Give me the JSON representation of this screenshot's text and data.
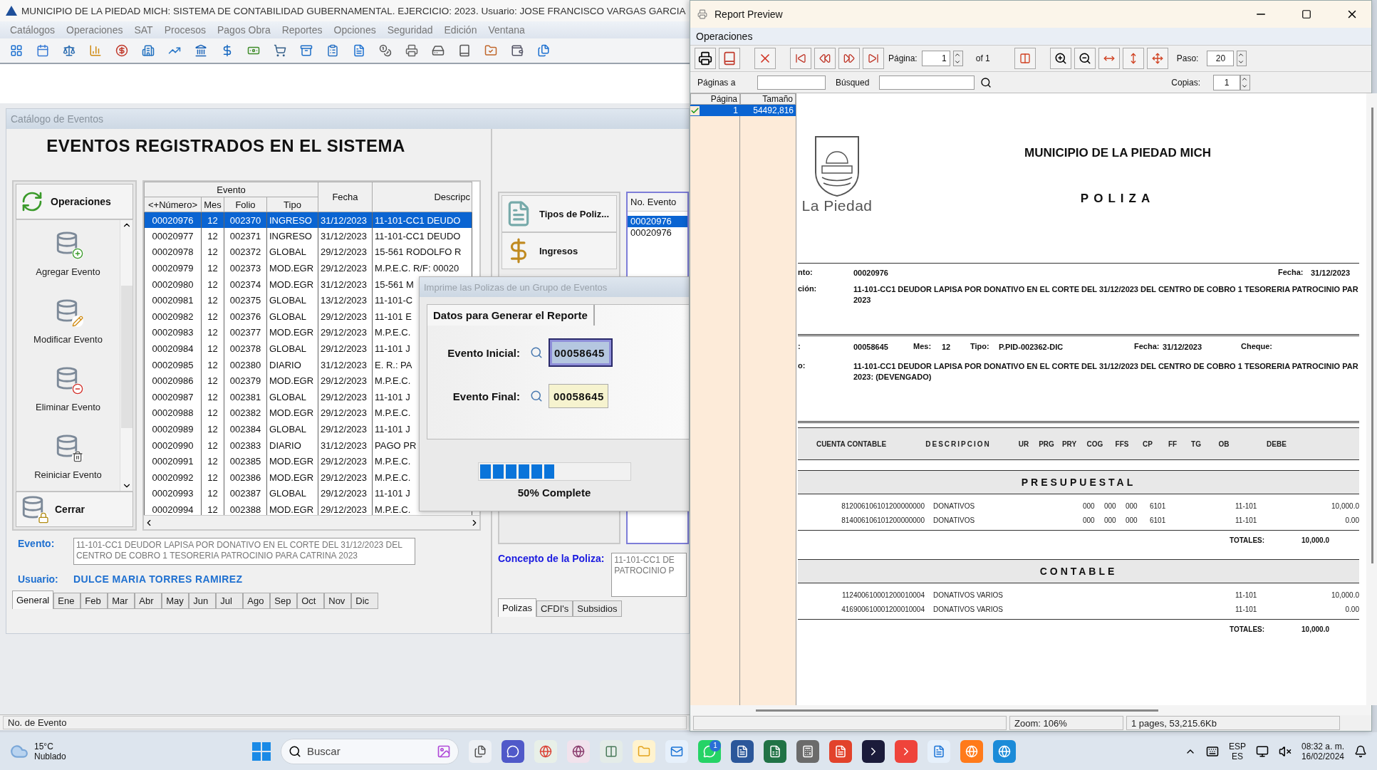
{
  "main_window": {
    "title": "MUNICIPIO DE LA PIEDAD MICH: SISTEMA DE CONTABILIDAD GUBERNAMENTAL. EJERCICIO: 2023. Usuario: JOSE FRANCISCO VARGAS GARCIA",
    "menu": [
      "Catálogos",
      "Operaciones",
      "SAT",
      "Procesos",
      "Pagos Obra",
      "Reportes",
      "Opciones",
      "Seguridad",
      "Edición",
      "Ventana"
    ],
    "status_bar": "No. de Evento"
  },
  "catalog": {
    "title": "Catálogo de Eventos",
    "heading": "EVENTOS REGISTRADOS EN EL SISTEMA",
    "operations": {
      "header": "Operaciones",
      "items": [
        {
          "label": "Agregar Evento",
          "kind": "add"
        },
        {
          "label": "Modificar Evento",
          "kind": "edit"
        },
        {
          "label": "Eliminar Evento",
          "kind": "delete"
        },
        {
          "label": "Reiniciar Evento",
          "kind": "reset"
        }
      ],
      "close": "Cerrar"
    },
    "table": {
      "group": "Evento",
      "columns": [
        "<+Número>",
        "Mes",
        "Folio",
        "Tipo",
        "Fecha",
        "Descripc"
      ],
      "rows": [
        {
          "cells": [
            "00020976",
            "12",
            "002370",
            "INGRESO",
            "31/12/2023",
            "11-101-CC1 DEUDO"
          ],
          "selected": true
        },
        {
          "cells": [
            "00020977",
            "12",
            "002371",
            "INGRESO",
            "31/12/2023",
            "11-101-CC1 DEUDO"
          ],
          "selected": false
        },
        {
          "cells": [
            "00020978",
            "12",
            "002372",
            "GLOBAL",
            "29/12/2023",
            "15-561 RODOLFO R"
          ],
          "selected": false
        },
        {
          "cells": [
            "00020979",
            "12",
            "002373",
            "MOD.EGR",
            "29/12/2023",
            "M.P.E.C. R/F: 00020"
          ],
          "selected": false
        },
        {
          "cells": [
            "00020980",
            "12",
            "002374",
            "MOD.EGR",
            "31/12/2023",
            "15-561 M"
          ],
          "selected": false
        },
        {
          "cells": [
            "00020981",
            "12",
            "002375",
            "GLOBAL",
            "13/12/2023",
            "11-101-C"
          ],
          "selected": false
        },
        {
          "cells": [
            "00020982",
            "12",
            "002376",
            "GLOBAL",
            "29/12/2023",
            "11-101 E"
          ],
          "selected": false
        },
        {
          "cells": [
            "00020983",
            "12",
            "002377",
            "MOD.EGR",
            "29/12/2023",
            "M.P.E.C."
          ],
          "selected": false
        },
        {
          "cells": [
            "00020984",
            "12",
            "002378",
            "GLOBAL",
            "29/12/2023",
            "11-101 J"
          ],
          "selected": false
        },
        {
          "cells": [
            "00020985",
            "12",
            "002380",
            "DIARIO",
            "31/12/2023",
            "E. R.: PA"
          ],
          "selected": false
        },
        {
          "cells": [
            "00020986",
            "12",
            "002379",
            "MOD.EGR",
            "29/12/2023",
            "M.P.E.C."
          ],
          "selected": false
        },
        {
          "cells": [
            "00020987",
            "12",
            "002381",
            "GLOBAL",
            "29/12/2023",
            "11-101 J"
          ],
          "selected": false
        },
        {
          "cells": [
            "00020988",
            "12",
            "002382",
            "MOD.EGR",
            "29/12/2023",
            "M.P.E.C."
          ],
          "selected": false
        },
        {
          "cells": [
            "00020989",
            "12",
            "002384",
            "GLOBAL",
            "29/12/2023",
            "11-101 J"
          ],
          "selected": false
        },
        {
          "cells": [
            "00020990",
            "12",
            "002383",
            "DIARIO",
            "31/12/2023",
            "PAGO PR"
          ],
          "selected": false
        },
        {
          "cells": [
            "00020991",
            "12",
            "002385",
            "MOD.EGR",
            "29/12/2023",
            "M.P.E.C."
          ],
          "selected": false
        },
        {
          "cells": [
            "00020992",
            "12",
            "002386",
            "MOD.EGR",
            "29/12/2023",
            "M.P.E.C."
          ],
          "selected": false
        },
        {
          "cells": [
            "00020993",
            "12",
            "002387",
            "GLOBAL",
            "29/12/2023",
            "11-101 J"
          ],
          "selected": false
        },
        {
          "cells": [
            "00020994",
            "12",
            "002388",
            "MOD.EGR",
            "29/12/2023",
            "M.P.E.C."
          ],
          "selected": false
        }
      ]
    },
    "side_items": [
      "Tipos de Poliz...",
      "Ingresos"
    ],
    "event_list": {
      "header": "No. Evento",
      "items": [
        {
          "label": "00020976",
          "selected": true
        },
        {
          "label": "00020976",
          "selected": false
        }
      ]
    },
    "evento_label": "Evento:",
    "evento_text": "11-101-CC1 DEUDOR LAPISA POR DONATIVO EN EL CORTE DEL 31/12/2023 DEL CENTRO DE COBRO 1 TESORERIA PATROCINIO PARA CATRINA 2023",
    "concepto_label": "Concepto de la Poliza:",
    "concepto_text": "11-101-CC1 DE\nPATROCINIO P",
    "usuario_label": "Usuario:",
    "usuario": "DULCE MARIA TORRES RAMIREZ",
    "month_tabs": [
      {
        "label": "General",
        "selected": true
      },
      {
        "label": "Ene",
        "selected": false
      },
      {
        "label": "Feb",
        "selected": false
      },
      {
        "label": "Mar",
        "selected": false
      },
      {
        "label": "Abr",
        "selected": false
      },
      {
        "label": "May",
        "selected": false
      },
      {
        "label": "Jun",
        "selected": false
      },
      {
        "label": "Jul",
        "selected": false
      },
      {
        "label": "Ago",
        "selected": false
      },
      {
        "label": "Sep",
        "selected": false
      },
      {
        "label": "Oct",
        "selected": false
      },
      {
        "label": "Nov",
        "selected": false
      },
      {
        "label": "Dic",
        "selected": false
      }
    ],
    "bottom_tabs": [
      {
        "label": "Polizas",
        "selected": true
      },
      {
        "label": "CFDI's",
        "selected": false
      },
      {
        "label": "Subsidios",
        "selected": false
      }
    ]
  },
  "dialog": {
    "title": "Imprime las Polizas de un Grupo de Eventos",
    "tab": "Datos para Generar el Reporte",
    "fields": [
      {
        "label": "Evento Inicial:",
        "value": "00058645",
        "focused": true
      },
      {
        "label": "Evento Final:",
        "value": "00058645",
        "focused": false
      }
    ],
    "progress": {
      "level": 0.5,
      "label": "50% Complete"
    }
  },
  "report": {
    "window_title": "Report Preview",
    "menu": "Operaciones",
    "page_label": "Página:",
    "page": "1",
    "of": "of 1",
    "paso_label": "Paso:",
    "paso": "20",
    "pages_label": "Páginas a",
    "search_label": "Búsqued",
    "copies_label": "Copias:",
    "copies": "1",
    "page_list": {
      "columns": [
        "Página",
        "Tamaño"
      ],
      "rows": [
        {
          "page": "1",
          "size": "54492,816",
          "checked": true,
          "selected": true
        }
      ]
    },
    "document": {
      "logo_text": "La Piedad",
      "org": "MUNICIPIO DE LA PIEDAD MICH",
      "doc_title": "POLIZA",
      "event": {
        "label": "nto:",
        "value": "00020976",
        "date_label": "Fecha:",
        "date": "31/12/2023"
      },
      "description": {
        "label": "ción:",
        "value": "11-101-CC1 DEUDOR LAPISA POR DONATIVO EN EL CORTE DEL 31/12/2023 DEL CENTRO DE COBRO 1 TESORERIA PATROCINIO PAR 2023"
      },
      "poliza": [
        {
          "label": ":",
          "value": "00058645"
        },
        {
          "label": "Mes:",
          "value": "12"
        },
        {
          "label": "Tipo:",
          "value": "P.PID-002362-DIC"
        },
        {
          "label": "Fecha:",
          "value": "31/12/2023"
        },
        {
          "label": "Cheque:"
        }
      ],
      "concept": {
        "label": "o:",
        "value": "11-101-CC1 DEUDOR LAPISA POR DONATIVO EN EL CORTE DEL 31/12/2023 DEL CENTRO DE COBRO 1 TESORERIA PATROCINIO PAR 2023: (DEVENGADO)"
      },
      "columns": [
        "CUENTA CONTABLE",
        "DESCRIPCION",
        "UR",
        "PRG",
        "PRY",
        "COG",
        "FFS",
        "CP",
        "FF",
        "TG",
        "OB",
        "DEBE"
      ],
      "sections": [
        {
          "title": "PRESUPUESTAL",
          "rows": [
            {
              "account": "812006106101200000000",
              "description": "DONATIVOS",
              "codes": [
                "000",
                "000",
                "000",
                "6101"
              ],
              "ff": "11-101",
              "debe": "10,000.0"
            },
            {
              "account": "814006106101200000000",
              "description": "DONATIVOS",
              "codes": [
                "000",
                "000",
                "000",
                "6101"
              ],
              "ff": "11-101",
              "debe": "0.00"
            }
          ],
          "total_label": "TOTALES:",
          "total": "10,000.0"
        },
        {
          "title": "CONTABLE",
          "rows": [
            {
              "account": "112400610001200010004",
              "description": "DONATIVOS VARIOS",
              "ff": "11-101",
              "debe": "10,000.0"
            },
            {
              "account": "416900610001200010004",
              "description": "DONATIVOS VARIOS",
              "ff": "11-101",
              "debe": "0.00"
            }
          ],
          "total_label": "TOTALES:",
          "total": "10,000.0"
        }
      ]
    },
    "status": [
      "Zoom: 106%",
      "1 pages, 53,215.6Kb"
    ]
  },
  "taskbar": {
    "temperature": "15°C",
    "weather": "Nublado",
    "search": "Buscar",
    "badge": "1",
    "language": "ESP",
    "layout": "ES",
    "time": "08:32 a. m.",
    "date": "16/02/2024"
  }
}
